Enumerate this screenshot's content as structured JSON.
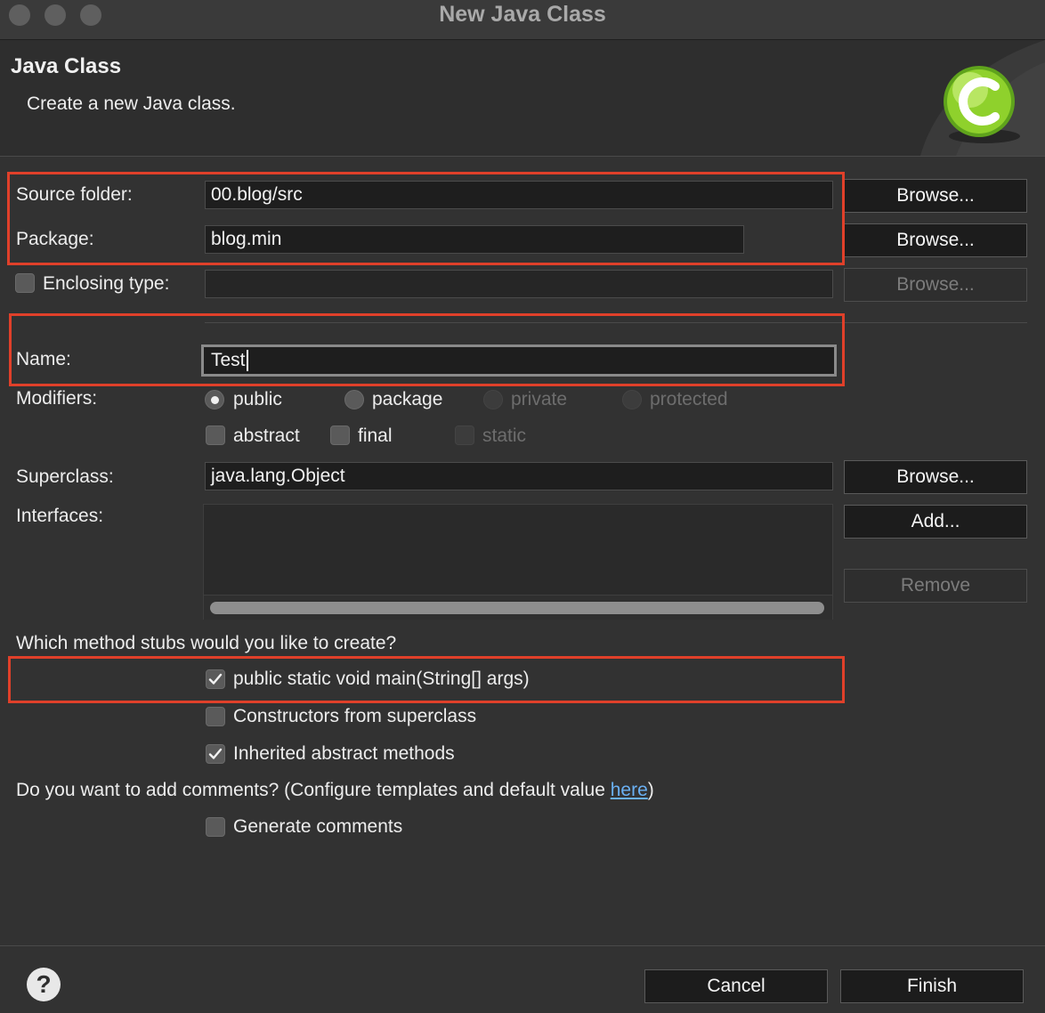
{
  "window": {
    "title": "New Java Class"
  },
  "header": {
    "title": "Java Class",
    "description": "Create a new Java class."
  },
  "fields": {
    "source_folder": {
      "label": "Source folder:",
      "value": "00.blog/src",
      "browse": "Browse..."
    },
    "package": {
      "label": "Package:",
      "value": "blog.min",
      "browse": "Browse..."
    },
    "enclosing_type": {
      "label": "Enclosing type:",
      "value": "",
      "browse": "Browse...",
      "checked": false
    },
    "name": {
      "label": "Name:",
      "value": "Test"
    },
    "superclass": {
      "label": "Superclass:",
      "value": "java.lang.Object",
      "browse": "Browse..."
    },
    "interfaces": {
      "label": "Interfaces:",
      "add": "Add...",
      "remove": "Remove"
    }
  },
  "modifiers": {
    "label": "Modifiers:",
    "access": [
      {
        "label": "public",
        "selected": true,
        "enabled": true
      },
      {
        "label": "package",
        "selected": false,
        "enabled": true
      },
      {
        "label": "private",
        "selected": false,
        "enabled": false
      },
      {
        "label": "protected",
        "selected": false,
        "enabled": false
      }
    ],
    "flags": [
      {
        "label": "abstract",
        "checked": false,
        "enabled": true
      },
      {
        "label": "final",
        "checked": false,
        "enabled": true
      },
      {
        "label": "static",
        "checked": false,
        "enabled": false
      }
    ]
  },
  "stubs": {
    "question": "Which method stubs would you like to create?",
    "options": [
      {
        "label": "public static void main(String[] args)",
        "checked": true
      },
      {
        "label": "Constructors from superclass",
        "checked": false
      },
      {
        "label": "Inherited abstract methods",
        "checked": true
      }
    ]
  },
  "comments": {
    "question_prefix": "Do you want to add comments? (Configure templates and default value ",
    "link": "here",
    "question_suffix": ")",
    "generate": {
      "label": "Generate comments",
      "checked": false
    }
  },
  "footer": {
    "help": "?",
    "cancel": "Cancel",
    "finish": "Finish"
  },
  "colors": {
    "highlight": "#e0402a",
    "link": "#6ab0f3",
    "background": "#323232"
  }
}
